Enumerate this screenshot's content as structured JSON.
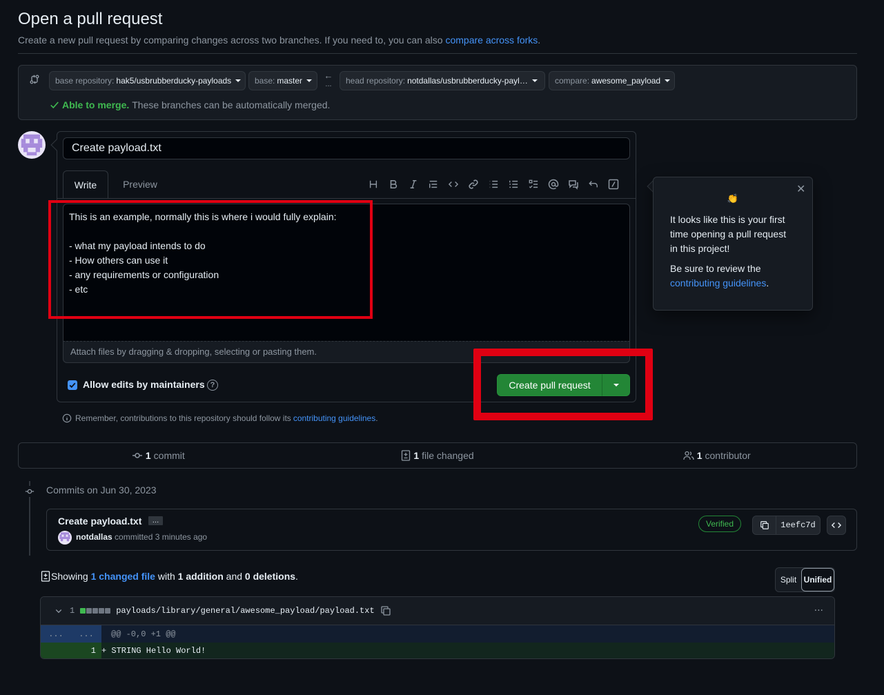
{
  "header": {
    "title": "Open a pull request",
    "subtitle": "Create a new pull request by comparing changes across two branches. If you need to, you can also",
    "subtitle_link": "compare across forks",
    "subtitle_end": "."
  },
  "range": {
    "base_repo_label": "base repository:",
    "base_repo_value": "hak5/usbrubberducky-payloads",
    "base_label": "base:",
    "base_value": "master",
    "arrow": "←",
    "arrow_dots": "...",
    "head_repo_label": "head repository:",
    "head_repo_value": "notdallas/usbrubberducky-payl…",
    "compare_label": "compare:",
    "compare_value": "awesome_payload",
    "merge_ok": "Able to merge.",
    "merge_text": "These branches can be automatically merged."
  },
  "composer": {
    "title_value": "Create payload.txt",
    "tab_write": "Write",
    "tab_preview": "Preview",
    "toolbar_tools": [
      "heading-icon",
      "bold-icon",
      "italic-icon",
      "quote-icon",
      "code-icon",
      "link-icon",
      "unordered-list-icon",
      "ordered-list-icon",
      "task-list-icon",
      "mention-icon",
      "reference-icon",
      "undo-icon",
      "slash-commands-icon"
    ],
    "body_text": "This is an example, normally this is where i would fully explain:\n\n- what my payload intends to do\n- How others can use it\n- any requirements or configuration\n- etc",
    "attach_text": "Attach files by dragging & dropping, selecting or pasting them.",
    "allow_edits_label": "Allow edits by maintainers",
    "allow_edits_checked": true,
    "help_glyph": "?",
    "create_button": "Create pull request",
    "remember_text": "Remember, contributions to this repository should follow its",
    "remember_link": "contributing guidelines",
    "remember_end": "."
  },
  "popover": {
    "emoji": "👏",
    "line1": "It looks like this is your first time opening a pull request in this project!",
    "line2": "Be sure to review the",
    "link": "contributing guidelines",
    "end": ".",
    "close": "✕"
  },
  "summary": {
    "commits_count": "1",
    "commits_label": "commit",
    "files_count": "1",
    "files_label": "file changed",
    "contributors_count": "1",
    "contributors_label": "contributor"
  },
  "commits": {
    "date_label": "Commits on Jun 30, 2023",
    "title": "Create payload.txt",
    "ellipsis": "…",
    "author": "notdallas",
    "meta": "committed 3 minutes ago",
    "verified": "Verified",
    "sha": "1eefc7d"
  },
  "diff": {
    "showing": "Showing",
    "changed_link": "1 changed file",
    "with": "with",
    "additions": "1 addition",
    "and": "and",
    "deletions": "0 deletions",
    "period": ".",
    "split": "Split",
    "unified": "Unified",
    "file_count": "1",
    "file_path": "payloads/library/general/awesome_payload/payload.txt",
    "hunk_dots_left": "...",
    "hunk_dots_right": "...",
    "hunk_header": "@@ -0,0 +1 @@",
    "line_number": "1",
    "line_text": "+ STRING Hello World!",
    "more": "···"
  },
  "colors": {
    "background": "#0d1117",
    "link": "#4493f8",
    "success": "#3fb950",
    "button_green": "#238636",
    "annotation_red": "#e00012"
  }
}
